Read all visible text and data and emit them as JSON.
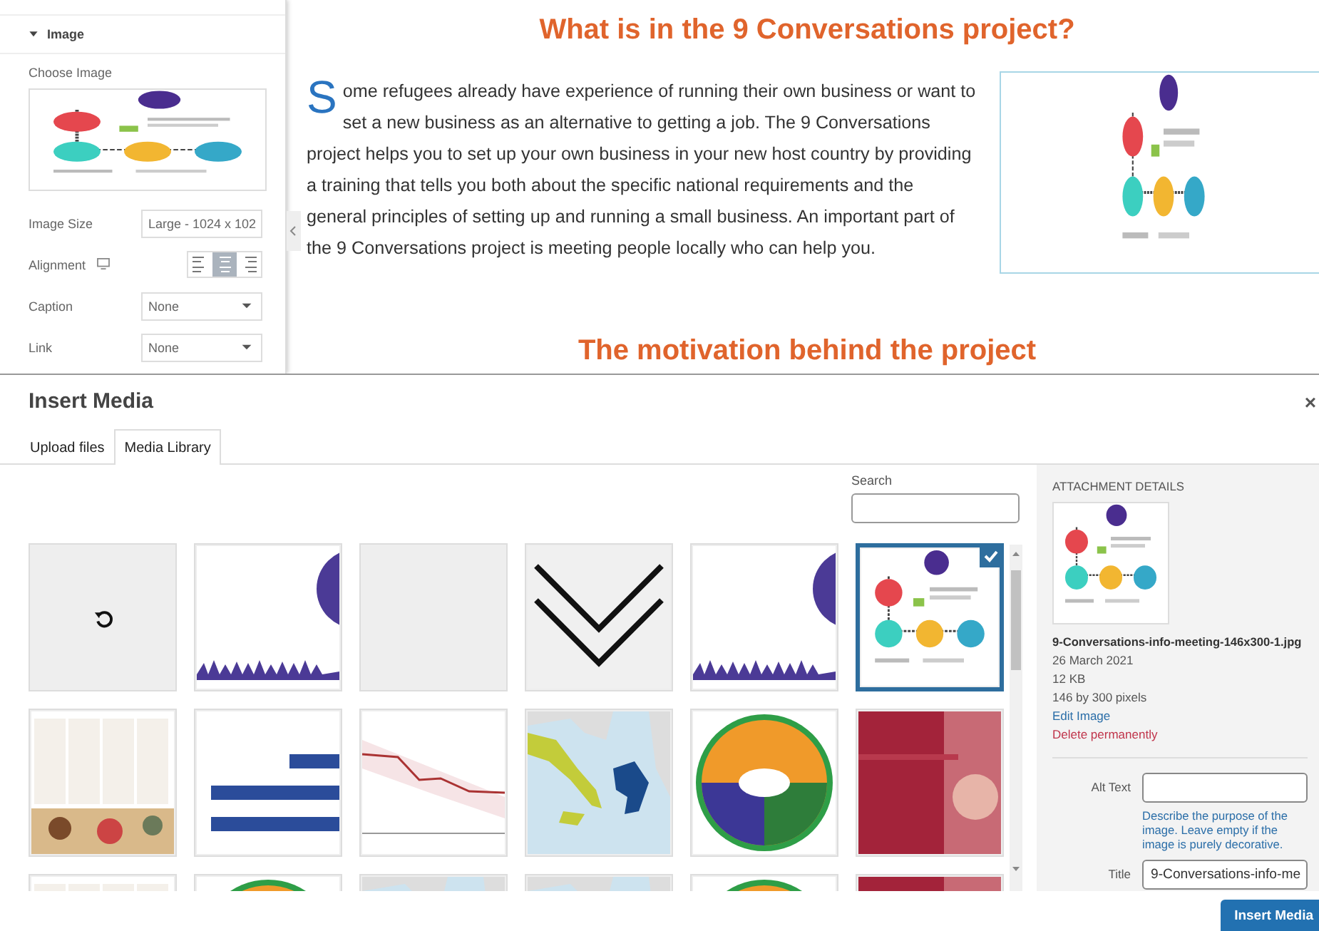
{
  "editor_panel": {
    "section_title": "Image",
    "expanded": true,
    "choose_image_label": "Choose Image",
    "preview": {
      "kind": "picture"
    },
    "fields": [
      {
        "label": "Image Size",
        "kind": "select",
        "value": "Large - 1024 x 102"
      },
      {
        "label": "Alignment",
        "kind": "align",
        "options": [
          {
            "selected": false
          },
          {
            "selected": true
          },
          {
            "selected": false
          }
        ]
      },
      {
        "label": "Caption",
        "kind": "select",
        "value": "None"
      },
      {
        "label": "Link",
        "kind": "select",
        "value": "None"
      }
    ]
  },
  "page": {
    "heading": "What is in the 9 Conversations project?",
    "paragraph": "Some refugees already have experience of running their own business or want to set a new business as an alternative to getting a job. The 9 Conversations project helps you to set up your own business in your new host country by providing a training that tells you both about the specific national requirements and the general principles of setting up and running a small business. An important part of the 9 Conversations project is meeting people locally who can help you.",
    "image": {
      "kind": "picture"
    },
    "next_heading": "The motivation behind the project"
  },
  "modal": {
    "title": "Insert Media",
    "close": "×",
    "tabs": [
      {
        "label": "Upload files",
        "selected": false
      },
      {
        "label": "Media Library",
        "selected": true
      }
    ],
    "search": {
      "label": "Search"
    },
    "items": [
      {
        "kind": "loading",
        "selected": false
      },
      {
        "kind": "picture",
        "selected": false
      },
      {
        "kind": "blank",
        "selected": false
      },
      {
        "kind": "picture",
        "selected": false
      },
      {
        "kind": "picture",
        "selected": false
      },
      {
        "kind": "picture",
        "selected": true
      },
      {
        "kind": "picture",
        "selected": false
      },
      {
        "kind": "picture",
        "selected": false
      },
      {
        "kind": "picture",
        "selected": false
      },
      {
        "kind": "picture",
        "selected": false
      },
      {
        "kind": "picture",
        "selected": false
      },
      {
        "kind": "picture",
        "selected": false
      },
      {
        "kind": "picture",
        "selected": false
      },
      {
        "kind": "picture",
        "selected": false
      },
      {
        "kind": "picture",
        "selected": false
      },
      {
        "kind": "picture",
        "selected": false
      },
      {
        "kind": "picture",
        "selected": false
      },
      {
        "kind": "picture",
        "selected": false
      }
    ],
    "details": {
      "heading": "ATTACHMENT DETAILS",
      "thumbnail": {
        "kind": "picture"
      },
      "filename": "9-Conversations-info-meeting-146x300-1.jpg",
      "date": "26 March 2021",
      "size": "12 KB",
      "dimensions": "146 by 300 pixels",
      "edit_link": "Edit Image",
      "delete_link": "Delete permanently",
      "fields": [
        {
          "label": "Alt Text",
          "description": "Describe the purpose of the image. Leave empty if the image is purely decorative."
        },
        {
          "label": "Title",
          "value": "9-Conversations-info-me"
        }
      ]
    },
    "button": "Insert Media"
  }
}
